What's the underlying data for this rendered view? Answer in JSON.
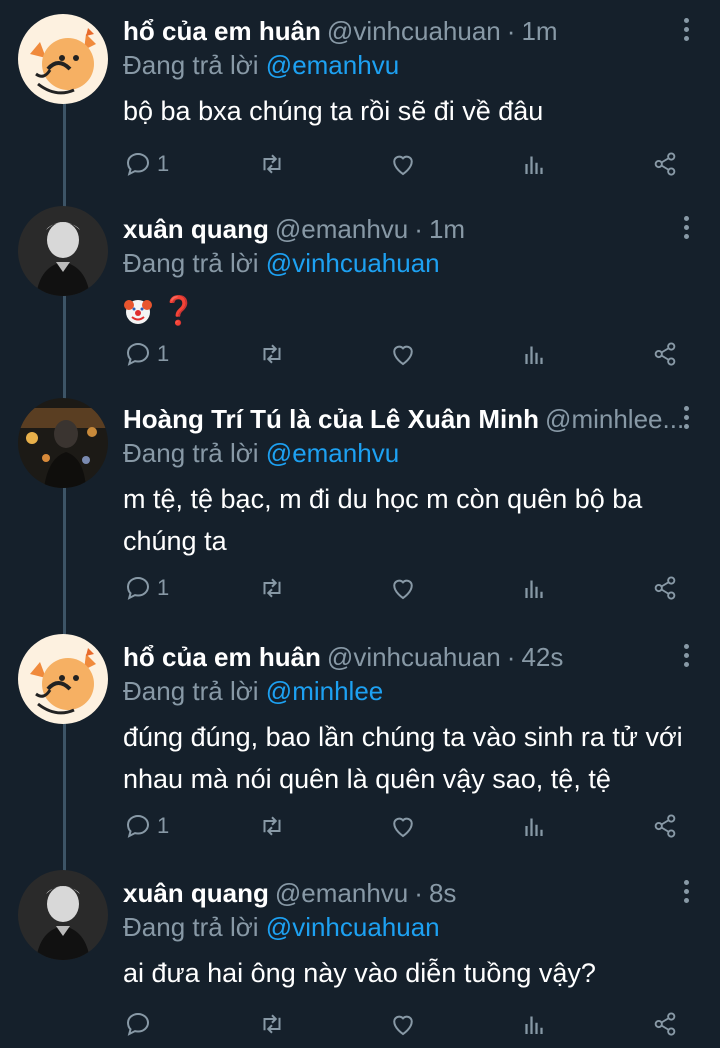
{
  "tweets": [
    {
      "name": "hổ của em huân",
      "handle": "@vinhcuahuan",
      "time": "1m",
      "reply_prefix": "Đang trả lời",
      "reply_to": "@emanhvu",
      "text": "bộ ba bxa chúng ta rồi sẽ đi về đâu",
      "reply_count": "1",
      "avatar": "tiger-avatar"
    },
    {
      "name": "xuân quang",
      "handle": "@emanhvu",
      "time": "1m",
      "reply_prefix": "Đang trả lời",
      "reply_to": "@vinhcuahuan",
      "text": "",
      "emoji_text": "❓",
      "reply_count": "1",
      "avatar": "person-avatar"
    },
    {
      "name": "Hoàng Trí Tú là của Lê Xuân Minh",
      "handle": "@minhlee...",
      "time": "",
      "reply_prefix": "Đang trả lời",
      "reply_to": "@emanhvu",
      "text": "m tệ, tệ bạc, m đi du học m còn quên bộ ba chúng ta",
      "reply_count": "1",
      "avatar": "night-avatar"
    },
    {
      "name": "hổ của em huân",
      "handle": "@vinhcuahuan",
      "time": "42s",
      "reply_prefix": "Đang trả lời",
      "reply_to": "@minhlee",
      "text": "đúng đúng, bao lần chúng ta vào sinh ra tử với nhau mà nói quên là quên vậy sao, tệ, tệ",
      "reply_count": "1",
      "avatar": "tiger-avatar"
    },
    {
      "name": "xuân quang",
      "handle": "@emanhvu",
      "time": "8s",
      "reply_prefix": "Đang trả lời",
      "reply_to": "@vinhcuahuan",
      "text": "ai đưa hai ông này vào diễn tuồng vậy?",
      "reply_count": "",
      "avatar": "person-avatar"
    }
  ],
  "dot": "·",
  "colors": {
    "background": "#15202b",
    "secondary_text": "#8899a6",
    "link": "#1da1f2",
    "thread_line": "#3d5466"
  },
  "icons": [
    "reply-icon",
    "retweet-icon",
    "like-icon",
    "stats-icon",
    "share-icon",
    "more-icon"
  ]
}
